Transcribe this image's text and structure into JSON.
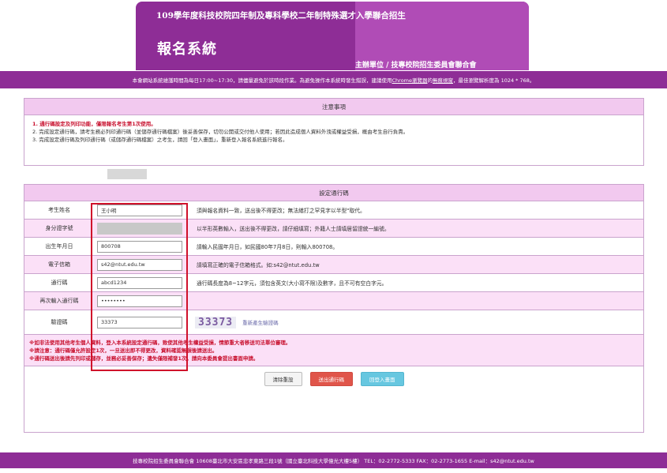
{
  "header": {
    "year_title": "109學年度科技校院四年制及專科學校二年制特殊選才入學聯合招生",
    "system_title": "報名系統",
    "organizer": "主辦單位 / 技專校院招生委員會聯合會"
  },
  "notice": {
    "text_before": "本會網站系統維護時間為每日17:00~17:30，請儘量避免於該時段作業。為避免操作本系統時發生錯誤，建議使用",
    "chrome_link": "Chrome瀏覽器",
    "text_middle": "的",
    "setup_link": "無痕視窗",
    "text_after": "，最佳瀏覽解析度為 1024 * 768。"
  },
  "notes": {
    "title": "注意事項",
    "items": [
      "1. 通行碼設定及列印功能，僅限報名考生第1次使用。",
      "2. 完成設定通行碼，請考生務必列印通行碼（並儲存通行碼檔案）後妥善保存，切勿公開或交付他人使用；若因此造成個人資料外洩或權益受損，概由考生自行負責。",
      "3. 完成設定通行碼及列印通行碼（或儲存通行碼檔案）之考生，請回「登入畫面」，重新登入報名系統進行報名。"
    ]
  },
  "form": {
    "title": "設定通行碼",
    "rows": [
      {
        "label": "考生姓名",
        "value": "王小明",
        "hint": "須與報名資料一致，送出後不得更改；無法繕打之罕見字以半型\"取代。"
      },
      {
        "label": "身分證字號",
        "value": "",
        "hint": "以半形英數輸入，送出後不得更改，請仔細填寫；外籍人士請填居留證統一編號。"
      },
      {
        "label": "出生年月日",
        "value": "800708",
        "hint": "請輸入民國年月日，如民國80年7月8日，則輸入800708。"
      },
      {
        "label": "電子信箱",
        "value": "s42@ntut.edu.tw",
        "hint": "請填寫正確的電子信箱格式。如:s42@ntut.edu.tw"
      },
      {
        "label": "通行碼",
        "value": "abcd1234",
        "hint": "通行碼長度為8~12字元，須包含英文(大小寫不限)及數字，且不可有空白字元。"
      },
      {
        "label": "再次輸入通行碼",
        "value": "••••••••",
        "hint": ""
      },
      {
        "label": "驗證碼",
        "value": "33373",
        "hint": ""
      }
    ],
    "captcha_text": "33373",
    "refresh_label": "重新產生驗證碼"
  },
  "warnings": [
    "※如非法使用其他考生個人資料，登入本系統設定通行碼，致使其他考生權益受損，情節重大者移送司法單位審理。",
    "※請注意：通行碼僅允許設定1次，一旦送出即不得更改，資料確認無誤後請送出。",
    "※通行碼送出後請先列印或儲存，並務必妥善保存；遺失僅限補發1次，請向本委員會提出書面申請。"
  ],
  "buttons": {
    "clear": "清除重設",
    "submit": "送出通行碼",
    "back": "回登入畫面"
  },
  "footer": {
    "text": "技專校院招生委員會聯合會 10608臺北市大安區忠孝東路三段1號（國立臺北科技大學億光大樓5樓） TEL：02-2772-5333 FAX：02-2773-1655 E-mail：s42@ntut.edu.tw"
  }
}
